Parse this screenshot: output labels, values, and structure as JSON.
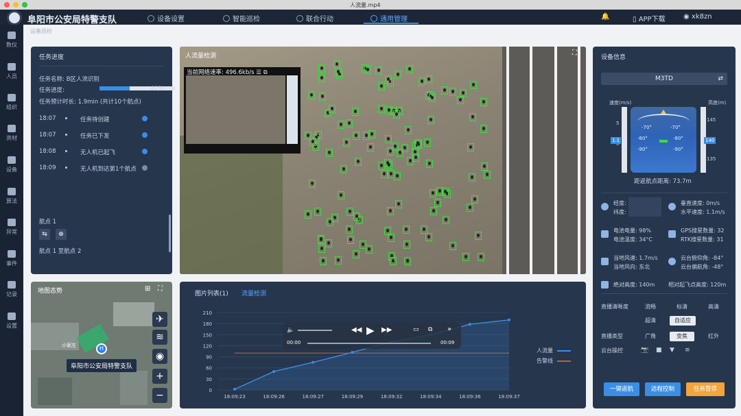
{
  "window": {
    "file_title": "人流量.mp4"
  },
  "app": {
    "title": "阜阳市公安局特警支队"
  },
  "nav": [
    {
      "label": "设备设置",
      "active": false
    },
    {
      "label": "智能巡检",
      "active": false
    },
    {
      "label": "联合行动",
      "active": false
    },
    {
      "label": "通用管理",
      "active": true
    }
  ],
  "topright": {
    "download": "APP下载",
    "user": "xk8zn"
  },
  "sidebar": [
    {
      "label": "数仪",
      "icon": "dashboard-icon"
    },
    {
      "label": "人员",
      "icon": "person-icon"
    },
    {
      "label": "组织",
      "icon": "org-icon"
    },
    {
      "label": "资材",
      "icon": "folder-icon"
    },
    {
      "label": "设备",
      "icon": "device-icon"
    },
    {
      "label": "算法",
      "icon": "algorithm-icon"
    },
    {
      "label": "异常",
      "icon": "alert-icon"
    },
    {
      "label": "事件",
      "icon": "event-icon"
    },
    {
      "label": "记录",
      "icon": "record-icon"
    },
    {
      "label": "设置",
      "icon": "gear-icon"
    }
  ],
  "breadcrumb": "设备巡检",
  "task": {
    "title": "任务进度",
    "name_label": "任务名称:",
    "name_value": "B区人流识别",
    "progress_label": "任务进度:",
    "progress_value": "40%",
    "progress_fraction": 0.4,
    "eta_label": "任务预计时长:",
    "eta_value": "1.9min (共计10个航点)",
    "steps": [
      {
        "time": "18:07",
        "label": "任务待创建",
        "done": true
      },
      {
        "time": "18:07",
        "label": "任务已下发",
        "done": true
      },
      {
        "time": "18:08",
        "label": "无人机已起飞",
        "done": true
      },
      {
        "time": "18:09",
        "label": "无人机到达第1个航点",
        "done": false
      }
    ],
    "waypoint_label": "航点 1",
    "waypoint_status": "航点 1 至航点 2"
  },
  "video": {
    "title": "人流量检测",
    "speed_label": "当前网络速率:",
    "speed_value": "496.6kb/s"
  },
  "map": {
    "title": "地图态势",
    "location_label": "阜阳市公安局特警支队",
    "marker_label": "H",
    "place_label": "小家庄"
  },
  "stats": {
    "tab1": "图片列表(1)",
    "tab2": "流量检测",
    "player": {
      "time_start": "00:00",
      "time_end": "00:09"
    },
    "legend": [
      {
        "name": "人流量",
        "color": "#3a8ee6"
      },
      {
        "name": "告警线",
        "color": "#c0622f"
      }
    ]
  },
  "chart_data": {
    "type": "line",
    "categories": [
      "18:09:23",
      "18:09:26",
      "18:09:27",
      "18:09:29",
      "18:09:32",
      "18:09:34",
      "18:09:36",
      "18:09:37"
    ],
    "series": [
      {
        "name": "人流量",
        "values": [
          2,
          50,
          75,
          102,
          130,
          150,
          178,
          190
        ]
      },
      {
        "name": "告警线",
        "values": [
          100,
          100,
          100,
          100,
          100,
          100,
          100,
          100
        ]
      }
    ],
    "yticks": [
      0,
      30,
      60,
      90,
      120,
      150,
      180,
      210
    ],
    "ylim": [
      0,
      210
    ],
    "legend_position": "right"
  },
  "device": {
    "title": "设备信息",
    "model": "M3TD",
    "speed_axis": "速度(m/s)",
    "alt_axis": "高度(m)",
    "speed_ticks": [
      "5",
      "0"
    ],
    "speed_value": "1.1",
    "alt_ticks": [
      "145",
      "140",
      "135"
    ],
    "alt_value": "140",
    "heading": [
      "-70°",
      "-80°",
      "-90°",
      "-70°",
      "-80°",
      "-90°"
    ],
    "distance_label": "距返航点距离:",
    "distance_value": "73.7m",
    "lng_label": "经度:",
    "lat_label": "纬度:",
    "vspeed_label": "垂直速度:",
    "vspeed_value": "0m/s",
    "hspeed_label": "水平速度:",
    "hspeed_value": "1.1m/s",
    "battery_label": "电池电量:",
    "battery_value": "98%",
    "battery_temp_label": "电池温度:",
    "battery_temp_value": "34°C",
    "gps_label": "GPS搜星数量:",
    "gps_value": "32",
    "rtk_label": "RTK搜星数量:",
    "rtk_value": "31",
    "wind_speed_label": "当地风速:",
    "wind_speed_value": "1.7m/s",
    "wind_dir_label": "当地风向:",
    "wind_dir_value": "东北",
    "gimbal_pitch_label": "云台俯仰角:",
    "gimbal_pitch_value": "-84°",
    "gimbal_yaw_label": "云台偏航角:",
    "gimbal_yaw_value": "-48°",
    "abs_alt_label": "绝对高度:",
    "abs_alt_value": "140m",
    "rel_alt_label": "相对起飞点高度:",
    "rel_alt_value": "120m",
    "clarity_label": "直播清晰度",
    "clarity_options": [
      "流畅",
      "标清",
      "高清",
      "超清",
      "自适应"
    ],
    "lens_label": "直播类型",
    "lens_options": [
      "广角",
      "变焦",
      "红外"
    ],
    "gimbal_label": "云台操控",
    "btn_return": "一键返航",
    "btn_remote": "远程控制",
    "btn_task": "任务暂停"
  }
}
